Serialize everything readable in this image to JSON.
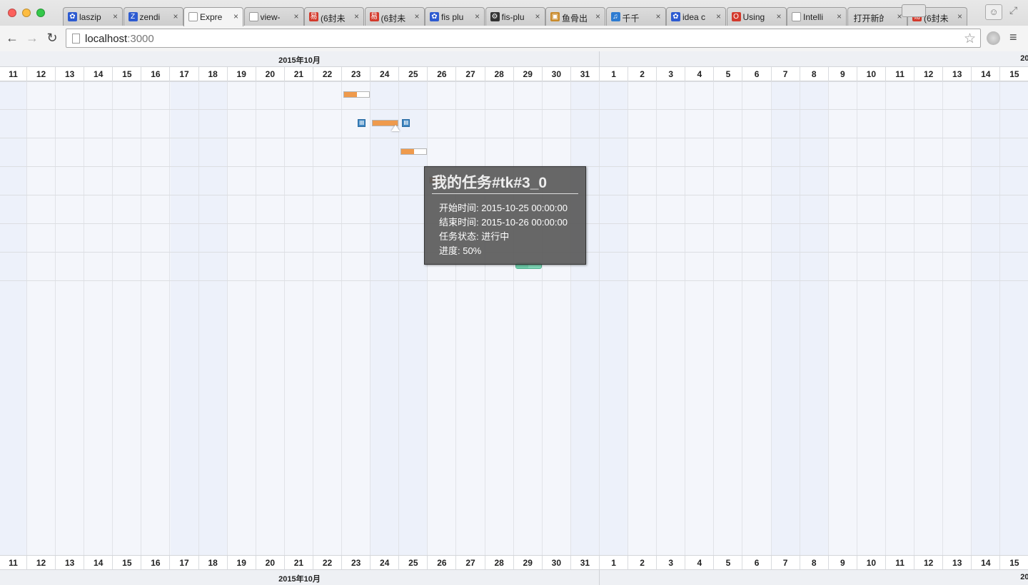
{
  "window": {
    "tabs": [
      {
        "label": "laszip",
        "icon": "paw-icon",
        "color": "#2d5bd1",
        "active": false
      },
      {
        "label": "zendi",
        "icon": "zend-icon",
        "color": "#2d5bd1",
        "active": false
      },
      {
        "label": "Expre",
        "icon": "page-icon",
        "color": "#999999",
        "active": true
      },
      {
        "label": "view-",
        "icon": "page-icon",
        "color": "#999999",
        "active": false
      },
      {
        "label": "(6封未",
        "icon": "mail163-icon",
        "color": "#d33a2c",
        "active": false
      },
      {
        "label": "(6封未",
        "icon": "mail163-icon",
        "color": "#d33a2c",
        "active": false
      },
      {
        "label": "fis plu",
        "icon": "paw-icon",
        "color": "#2d5bd1",
        "active": false
      },
      {
        "label": "fis-plu",
        "icon": "github-icon",
        "color": "#333333",
        "active": false
      },
      {
        "label": "鱼骨出",
        "icon": "image-icon",
        "color": "#c98a2a",
        "active": false
      },
      {
        "label": "千千",
        "icon": "headphone-icon",
        "color": "#2d7bd1",
        "active": false
      },
      {
        "label": "idea c",
        "icon": "paw-icon",
        "color": "#2d5bd1",
        "active": false
      },
      {
        "label": "Using",
        "icon": "oracle-icon",
        "color": "#d33a2c",
        "active": false
      },
      {
        "label": "Intelli",
        "icon": "page-icon",
        "color": "#999999",
        "active": false
      },
      {
        "label": "打开新的",
        "icon": "none",
        "color": "#999999",
        "active": false
      },
      {
        "label": "(6封未",
        "icon": "mail163-icon",
        "color": "#d33a2c",
        "active": false
      }
    ],
    "tab_close": "×",
    "url_host": "localhost",
    "url_port": ":3000",
    "back": "←",
    "forward": "→",
    "reload": "↻",
    "star": "☆",
    "menu": "≡",
    "profile": "☺",
    "fullscreen": "⤢"
  },
  "gantt": {
    "months": [
      {
        "label": "2015年10月",
        "days": 21
      },
      {
        "label": "20",
        "days": 15
      }
    ],
    "days": [
      "11",
      "12",
      "13",
      "14",
      "15",
      "16",
      "17",
      "18",
      "19",
      "20",
      "21",
      "22",
      "23",
      "24",
      "25",
      "26",
      "27",
      "28",
      "29",
      "30",
      "31",
      "1",
      "2",
      "3",
      "4",
      "5",
      "6",
      "7",
      "8",
      "9",
      "10",
      "11",
      "12",
      "13",
      "14",
      "15"
    ],
    "weekend_index": [
      0,
      6,
      7,
      13,
      14,
      20,
      21,
      27,
      28,
      34,
      35
    ],
    "row_count": 7,
    "tasks": [
      {
        "row": 0,
        "start_day_index": 12,
        "span": 1,
        "progress": 0.5,
        "style": "orange"
      },
      {
        "row": 1,
        "start_day_index": 13,
        "span": 1,
        "progress": 1.0,
        "style": "orange-selected"
      },
      {
        "row": 2,
        "start_day_index": 14,
        "span": 1,
        "progress": 0.5,
        "style": "orange"
      },
      {
        "row": 3,
        "start_day_index": 15,
        "span": 1,
        "progress": 0.5,
        "style": "orange"
      },
      {
        "row": 6,
        "start_day_index": 18,
        "span": 1,
        "progress": 0.5,
        "style": "green"
      }
    ],
    "handle_label": "III",
    "tooltip": {
      "title": "我的任务#tk#3_0",
      "start": "开始时间: 2015-10-25 00:00:00",
      "end": "结束时间: 2015-10-26 00:00:00",
      "status": "任务状态: 进行中",
      "progress": "进度: 50%"
    }
  }
}
